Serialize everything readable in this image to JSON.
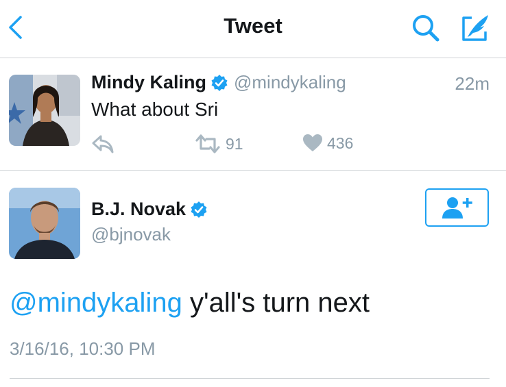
{
  "header": {
    "title": "Tweet",
    "back_icon": "chevron-left-icon",
    "search_icon": "search-icon",
    "compose_icon": "compose-tweet-icon"
  },
  "reply_tweet": {
    "name": "Mindy Kaling",
    "handle": "@mindykaling",
    "time": "22m",
    "text": "What about Sri",
    "retweets": "91",
    "likes": "436"
  },
  "main_tweet": {
    "name": "B.J. Novak",
    "handle": "@bjnovak",
    "mention": "@mindykaling",
    "text": " y'all's turn next",
    "timestamp": "3/16/16, 10:30 PM",
    "follow_icon": "add-user-icon"
  },
  "colors": {
    "accent": "#1da1f2",
    "secondary_text": "#8899a6",
    "divider": "#cfd3d6"
  }
}
